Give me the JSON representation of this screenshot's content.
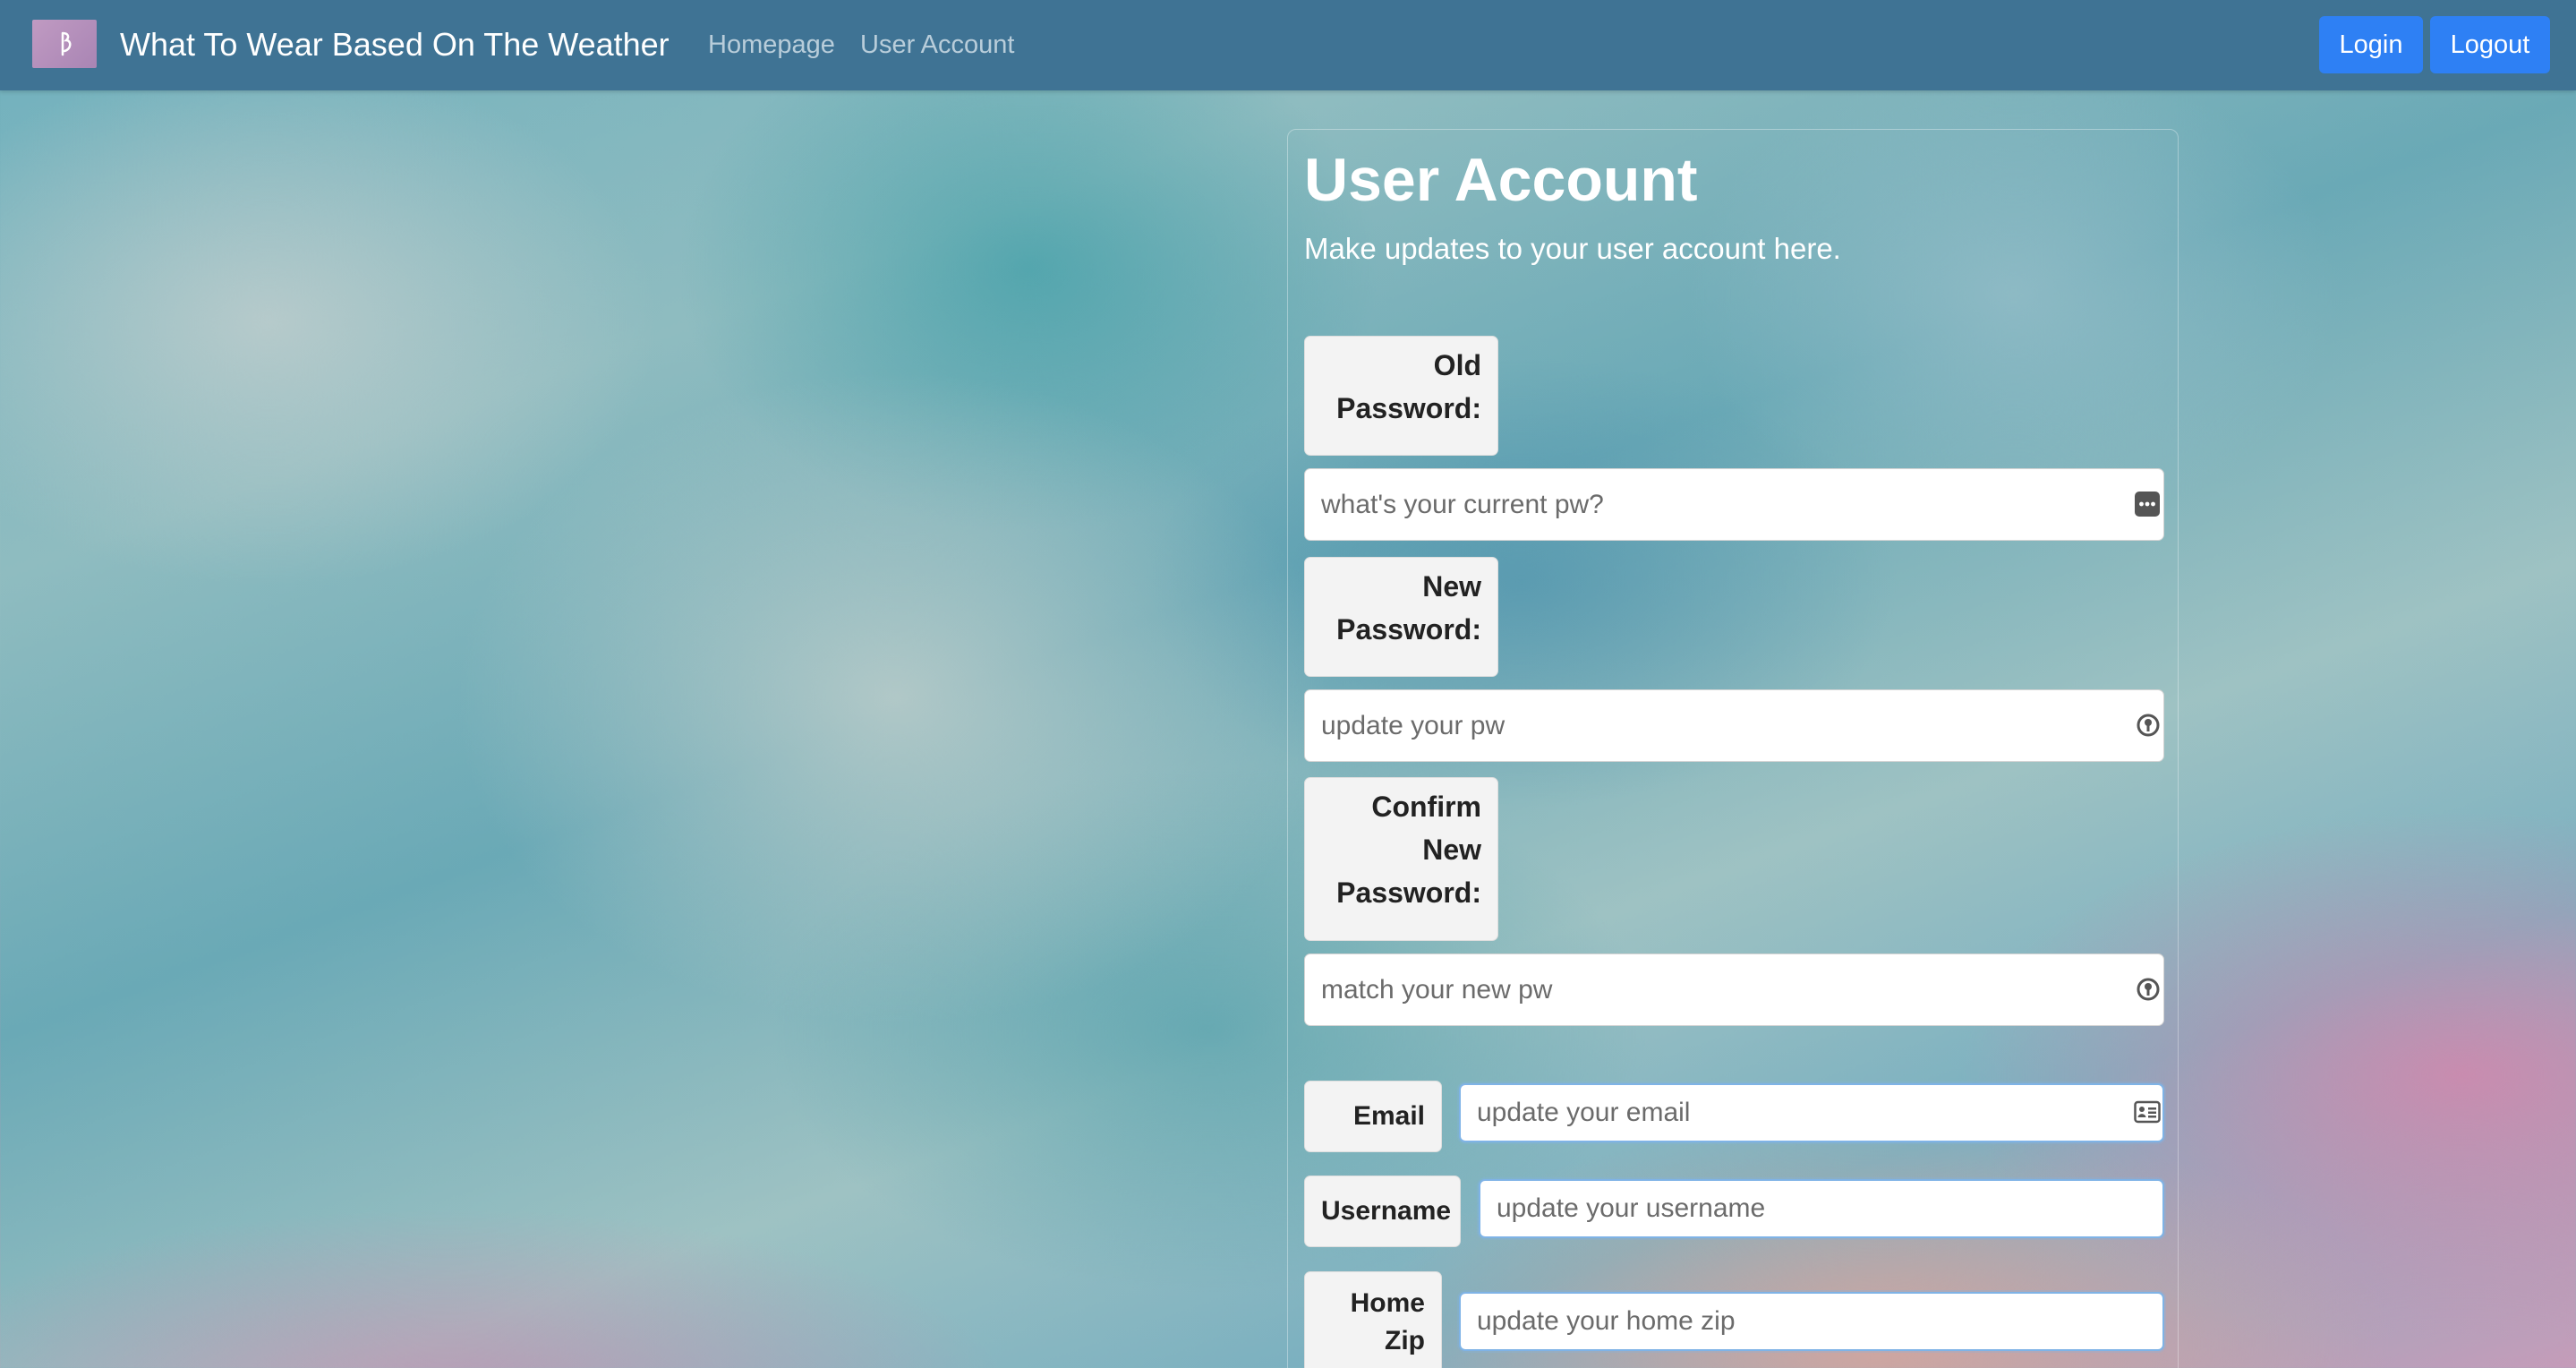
{
  "navbar": {
    "brand_title": "What To Wear Based On The Weather",
    "links": [
      {
        "label": "Homepage"
      },
      {
        "label": "User Account"
      }
    ],
    "buttons": {
      "login": "Login",
      "logout": "Logout"
    },
    "colors": {
      "navbar_bg": "#3f7394",
      "button_bg": "#2e80f4"
    }
  },
  "main": {
    "title": "User Account",
    "subtitle": "Make updates to your user account here.",
    "fields": {
      "old_password": {
        "label": "Old Password:",
        "value": "",
        "placeholder": "what's your current pw?",
        "icon": "password-dots-icon"
      },
      "new_password": {
        "label": "New Password:",
        "value": "",
        "placeholder": "update your pw",
        "icon": "key-icon"
      },
      "confirm_password": {
        "label": "Confirm New Password:",
        "value": "",
        "placeholder": "match your new pw",
        "icon": "key-icon"
      },
      "email": {
        "label": "Email",
        "value": "",
        "placeholder": "update your email",
        "icon": "contact-card-icon"
      },
      "username": {
        "label": "Username",
        "value": "",
        "placeholder": "update your username"
      },
      "home_zip": {
        "label": "Home Zip",
        "value": "",
        "placeholder": "update your home zip"
      }
    }
  }
}
